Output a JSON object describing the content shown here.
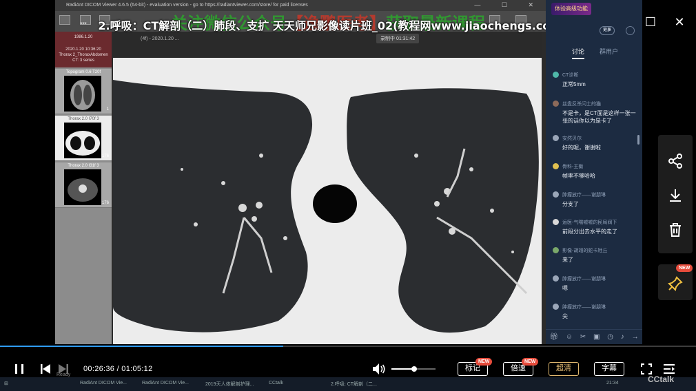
{
  "video": {
    "title": "2.呼吸：CT解剖（二）肺段、支扩 天天师兄影像读片班_02(教程网www.jiaochengs.com).mp4",
    "watermark_green": "关注微信公众号",
    "watermark_red": "【逸鹏医考】",
    "watermark_tail": "获取最新课程",
    "viewer_title": "RadiAnt DICOM Viewer 4.6.5 (64-bit) - evaluation version - go to https://radiantviewer.com/store/ for paid licenses",
    "recording_badge": "录制中 01:31:42",
    "patient": {
      "dots": "***",
      "dob": "1986.1.20",
      "study_line1": "2020.1.20 10:36:20",
      "study_line2": "Thorax 2_ThoraxAbdomen",
      "study_line3": "CT: 3 series"
    },
    "series": [
      {
        "label": "Topogram 0.6 T20f",
        "count": "1"
      },
      {
        "label": "Thorax 2.0 I70f 3",
        "count": "176"
      },
      {
        "label": "Thorax 2.0 I31f 3",
        "count": "176"
      }
    ],
    "scan_info": "(4f) - 2020.1.20 ...",
    "ready_text": "Ready"
  },
  "window_controls": {
    "minimize": "—",
    "restore": "☐",
    "close": "✕"
  },
  "chat": {
    "promo": "体验高级功能",
    "btn_more": "更多",
    "btn_share": "分享",
    "tabs": [
      {
        "label": "讨论"
      },
      {
        "label": "群用户"
      }
    ],
    "messages": [
      {
        "name": "CT诊断",
        "text": "正常5mm"
      },
      {
        "name": "丝盘反杀闪士的猫",
        "text": "不是卡，是CT面是这样一张一张的话你以为是卡了"
      },
      {
        "name": "安然贝尔",
        "text": "好的呢，谢谢啦"
      },
      {
        "name": "骨科-王衡",
        "text": "帧率不够哈哈"
      },
      {
        "name": "肿瘤放疗——谢朋琳",
        "text": "分支了"
      },
      {
        "name": "运医-气喘嘘嘘的民局阀下",
        "text": "前段分出去水平的走了"
      },
      {
        "name": "影像-胡翊的蛇卡姓丘",
        "text": "来了"
      },
      {
        "name": "肿瘤放疗——谢朋琳",
        "text": "嗯"
      },
      {
        "name": "肿瘤放疗——谢朋琳",
        "text": "尖"
      }
    ]
  },
  "side_buttons": {
    "new_badge": "NEW"
  },
  "player": {
    "progress_fraction": 0.4065,
    "current_time": "00:26:36",
    "total_time": "01:05:12",
    "volume_fraction": 0.52,
    "btn_mark": "标记",
    "btn_speed": "倍速",
    "btn_quality": "超清",
    "btn_subtitle": "字幕",
    "new_badge": "NEW",
    "brand": "CCtalk"
  },
  "taskbar": {
    "items": [
      "RadiAnt DICOM Vie...",
      "RadiAnt DICOM Vie...",
      "2019天人体解剖护理...",
      "CCtalk",
      "2.呼吸: CT解剖（二..."
    ],
    "time": "21:34"
  },
  "colors": {
    "accent_blue": "#2f9bf2",
    "chat_bg": "#1c2b41",
    "badge_red": "#e74c3c",
    "quality_gold": "#e0b870"
  }
}
